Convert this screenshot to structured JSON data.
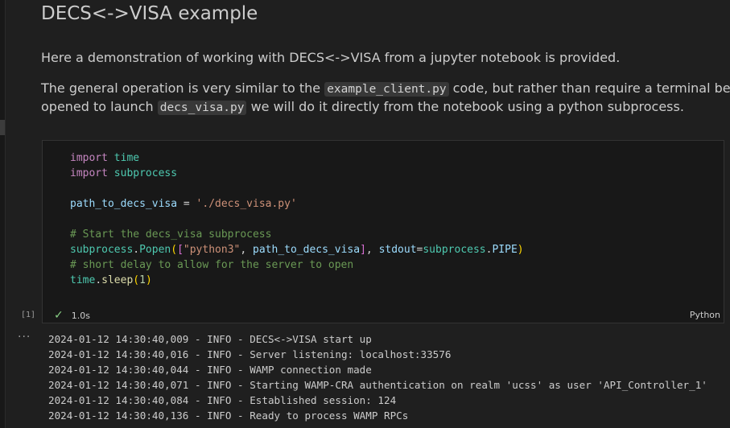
{
  "markdown": {
    "heading": "DECS<->VISA example",
    "para1": "Here a demonstration of working with DECS<->VISA from a jupyter notebook is provided.",
    "para2_part1": "The general operation is very similar to the ",
    "para2_code1": "example_client.py",
    "para2_part2": " code, but rather than require a terminal be",
    "para2_part3": "opened to launch ",
    "para2_code2": "decs_visa.py",
    "para2_part4": " we will do it directly from the notebook using a python subprocess."
  },
  "cell": {
    "execution_count": "[1]",
    "status_icon": "check-icon",
    "duration": "1.0s",
    "language": "Python",
    "code": {
      "import_kw": "import",
      "mod_time": "time",
      "mod_subprocess": "subprocess",
      "var_path": "path_to_decs_visa",
      "assign": " = ",
      "path_str": "'./decs_visa.py'",
      "comment1": "# Start the decs_visa subprocess",
      "popen_obj": "subprocess",
      "popen_fn": "Popen",
      "popen_str": "\"python3\"",
      "popen_kwarg": "stdout",
      "popen_const": "PIPE",
      "comment2": "# short delay to allow for the server to open",
      "sleep_fn": "sleep",
      "sleep_arg": "1"
    }
  },
  "output": {
    "more_icon": "ellipsis-icon",
    "lines": [
      "2024-01-12 14:30:40,009 - INFO - DECS<->VISA start up",
      "2024-01-12 14:30:40,016 - INFO - Server listening: localhost:33576",
      "2024-01-12 14:30:40,044 - INFO - WAMP connection made",
      "2024-01-12 14:30:40,071 - INFO - Starting WAMP-CRA authentication on realm 'ucss' as user 'API_Controller_1'",
      "2024-01-12 14:30:40,084 - INFO - Established session: 124",
      "2024-01-12 14:30:40,136 - INFO - Ready to process WAMP RPCs"
    ]
  }
}
